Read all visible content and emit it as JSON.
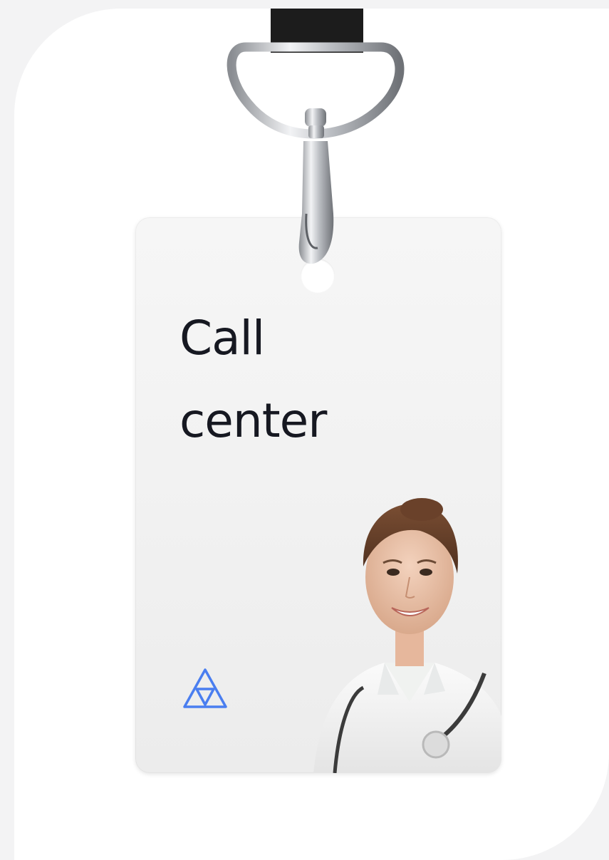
{
  "badge": {
    "title": "Call\ncenter",
    "logo_icon": "triangle-logo-icon",
    "logo_color": "#4a7ef0"
  },
  "colors": {
    "page_background": "#f3f3f4",
    "card_background": "#ffffff",
    "badge_background": "#f3f3f3",
    "strap": "#1c1c1c",
    "title_text": "#161821"
  }
}
